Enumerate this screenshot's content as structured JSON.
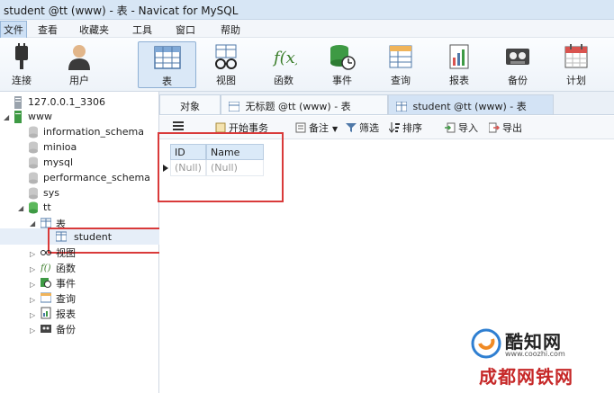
{
  "window": {
    "title": "student @tt (www) - 表 - Navicat for MySQL"
  },
  "menu": [
    "文件",
    "查看",
    "收藏夹",
    "工具",
    "窗口",
    "帮助"
  ],
  "toolbar": [
    {
      "label": "连接",
      "icon": "plug-icon"
    },
    {
      "label": "用户",
      "icon": "user-icon"
    },
    {
      "label": "表",
      "icon": "table-icon"
    },
    {
      "label": "视图",
      "icon": "glasses-icon"
    },
    {
      "label": "函数",
      "icon": "function-icon"
    },
    {
      "label": "事件",
      "icon": "event-icon"
    },
    {
      "label": "查询",
      "icon": "query-icon"
    },
    {
      "label": "报表",
      "icon": "report-icon"
    },
    {
      "label": "备份",
      "icon": "tape-icon"
    },
    {
      "label": "计划",
      "icon": "calendar-icon"
    }
  ],
  "tree": {
    "connection": "127.0.0.1_3306",
    "server": "www",
    "databases": [
      "information_schema",
      "minioa",
      "mysql",
      "performance_schema",
      "sys",
      "tt"
    ],
    "tt_children": {
      "tables": "表",
      "table_items": [
        "student"
      ],
      "others": [
        "视图",
        "函数",
        "事件",
        "查询",
        "报表",
        "备份"
      ]
    }
  },
  "tabs": [
    "对象",
    "无标题 @tt (www) - 表",
    "student @tt (www) - 表"
  ],
  "subtoolbar": {
    "begin_transaction": "开始事务",
    "memo": "备注",
    "filter": "筛选",
    "sort": "排序",
    "import": "导入",
    "export": "导出"
  },
  "grid": {
    "columns": [
      "ID",
      "Name"
    ],
    "rows": [
      [
        "(Null)",
        "(Null)"
      ]
    ]
  },
  "watermark": {
    "brand": "酷知网",
    "url": "www.coozhi.com",
    "brand2": "成都网铁网"
  }
}
